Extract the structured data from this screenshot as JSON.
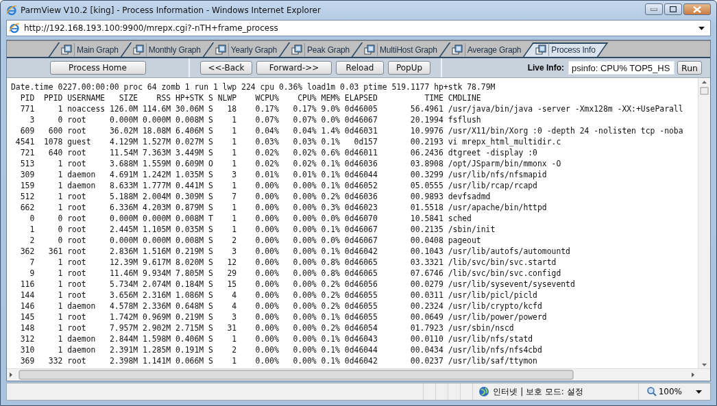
{
  "window": {
    "title": "ParmView V10.2 [king] - Process Information - Windows Internet Explorer"
  },
  "address_bar": {
    "url": "http://192.168.193.100:9900/mrepx.cgi?-nTH+frame_process"
  },
  "tabs": [
    {
      "label": "Main Graph",
      "selected": false
    },
    {
      "label": "Monthly Graph",
      "selected": false
    },
    {
      "label": "Yearly Graph",
      "selected": false
    },
    {
      "label": "Peak Graph",
      "selected": false
    },
    {
      "label": "MultiHost Graph",
      "selected": false
    },
    {
      "label": "Average Graph",
      "selected": false
    },
    {
      "label": "Process Info",
      "selected": true
    }
  ],
  "toolbar": {
    "home_button": "Process Home",
    "nav_buttons": [
      "<<-Back",
      "Forward->>",
      "Reload",
      "PopUp"
    ],
    "live_info_label": "Live Info:",
    "live_info_value": "psinfo: CPU% TOP5_HS",
    "run_button": "Run"
  },
  "process_table": {
    "summary": "Date.time 0227.00:00:00 proc 64 zomb 1 run 1 lwp 224 cpu 0.36% load1m 0.03 ptime 519.1177 hp+stk 78.79M",
    "columns": [
      "PID",
      "PPID",
      "USERNAME",
      "SIZE",
      "RSS",
      "HP+STK",
      "S",
      "NLWP",
      "WCPU%",
      "CPU%",
      "MEM%",
      "ELAPSED",
      "TIME",
      "CMDLINE"
    ],
    "rows": [
      [
        "771",
        "1",
        "noaccess",
        "126.0M",
        "114.6M",
        "30.06M",
        "S",
        "18",
        "0.17%",
        "0.17%",
        "9.0%",
        "0d46005",
        "56.4961",
        "/usr/java/bin/java -server -Xmx128m -XX:+UseParall"
      ],
      [
        "3",
        "0",
        "root",
        "0.000M",
        "0.000M",
        "0.008M",
        "S",
        "1",
        "0.07%",
        "0.07%",
        "0.0%",
        "0d46067",
        "20.1994",
        "fsflush"
      ],
      [
        "609",
        "600",
        "root",
        "36.02M",
        "18.08M",
        "6.406M",
        "S",
        "1",
        "0.04%",
        "0.04%",
        "1.4%",
        "0d46031",
        "10.9976",
        "/usr/X11/bin/Xorg :0 -depth 24 -nolisten tcp -noba"
      ],
      [
        "4541",
        "1078",
        "guest",
        "4.129M",
        "1.527M",
        "0.027M",
        "S",
        "1",
        "0.03%",
        "0.03%",
        "0.1%",
        "0d157",
        "00.2193",
        "vi mrepx_html_multidir.c"
      ],
      [
        "721",
        "640",
        "root",
        "11.54M",
        "7.363M",
        "3.449M",
        "S",
        "1",
        "0.02%",
        "0.02%",
        "0.6%",
        "0d46011",
        "06.2436",
        "dtgreet -display :0"
      ],
      [
        "513",
        "1",
        "root",
        "3.688M",
        "1.559M",
        "0.609M",
        "O",
        "1",
        "0.02%",
        "0.02%",
        "0.1%",
        "0d46036",
        "03.8908",
        "/opt/JSparm/bin/mmonx -O"
      ],
      [
        "309",
        "1",
        "daemon",
        "4.691M",
        "1.242M",
        "1.035M",
        "S",
        "3",
        "0.01%",
        "0.01%",
        "0.1%",
        "0d46044",
        "00.3299",
        "/usr/lib/nfs/nfsmapid"
      ],
      [
        "159",
        "1",
        "daemon",
        "8.633M",
        "1.777M",
        "0.441M",
        "S",
        "1",
        "0.00%",
        "0.00%",
        "0.1%",
        "0d46052",
        "05.0555",
        "/usr/lib/rcap/rcapd"
      ],
      [
        "512",
        "1",
        "root",
        "5.188M",
        "2.004M",
        "0.309M",
        "S",
        "7",
        "0.00%",
        "0.00%",
        "0.2%",
        "0d46036",
        "00.9893",
        "devfsadmd"
      ],
      [
        "662",
        "1",
        "root",
        "6.336M",
        "4.203M",
        "0.879M",
        "S",
        "1",
        "0.00%",
        "0.00%",
        "0.3%",
        "0d46023",
        "01.5518",
        "/usr/apache/bin/httpd"
      ],
      [
        "0",
        "0",
        "root",
        "0.000M",
        "0.000M",
        "0.008M",
        "T",
        "1",
        "0.00%",
        "0.00%",
        "0.0%",
        "0d46070",
        "10.5841",
        "sched"
      ],
      [
        "1",
        "0",
        "root",
        "2.445M",
        "1.105M",
        "0.035M",
        "S",
        "1",
        "0.00%",
        "0.00%",
        "0.1%",
        "0d46067",
        "00.2135",
        "/sbin/init"
      ],
      [
        "2",
        "0",
        "root",
        "0.000M",
        "0.000M",
        "0.008M",
        "S",
        "2",
        "0.00%",
        "0.00%",
        "0.0%",
        "0d46067",
        "00.0408",
        "pageout"
      ],
      [
        "362",
        "361",
        "root",
        "2.836M",
        "1.516M",
        "0.219M",
        "S",
        "3",
        "0.00%",
        "0.00%",
        "0.1%",
        "0d46042",
        "00.1043",
        "/usr/lib/autofs/automountd"
      ],
      [
        "7",
        "1",
        "root",
        "12.39M",
        "9.617M",
        "8.020M",
        "S",
        "12",
        "0.00%",
        "0.00%",
        "0.8%",
        "0d46065",
        "03.3321",
        "/lib/svc/bin/svc.startd"
      ],
      [
        "9",
        "1",
        "root",
        "11.46M",
        "9.934M",
        "7.805M",
        "S",
        "29",
        "0.00%",
        "0.00%",
        "0.8%",
        "0d46065",
        "07.6746",
        "/lib/svc/bin/svc.configd"
      ],
      [
        "116",
        "1",
        "root",
        "5.734M",
        "2.074M",
        "0.184M",
        "S",
        "15",
        "0.00%",
        "0.00%",
        "0.2%",
        "0d46056",
        "00.0279",
        "/usr/lib/sysevent/syseventd"
      ],
      [
        "144",
        "1",
        "root",
        "3.656M",
        "2.316M",
        "1.086M",
        "S",
        "4",
        "0.00%",
        "0.00%",
        "0.2%",
        "0d46055",
        "00.0311",
        "/usr/lib/picl/picld"
      ],
      [
        "146",
        "1",
        "daemon",
        "4.578M",
        "2.336M",
        "0.648M",
        "S",
        "4",
        "0.00%",
        "0.00%",
        "0.2%",
        "0d46055",
        "00.2324",
        "/usr/lib/crypto/kcfd"
      ],
      [
        "145",
        "1",
        "root",
        "1.742M",
        "0.969M",
        "0.219M",
        "S",
        "3",
        "0.00%",
        "0.00%",
        "0.1%",
        "0d46055",
        "00.0649",
        "/usr/lib/power/powerd"
      ],
      [
        "148",
        "1",
        "root",
        "7.957M",
        "2.902M",
        "2.715M",
        "S",
        "31",
        "0.00%",
        "0.00%",
        "0.2%",
        "0d46054",
        "01.7923",
        "/usr/sbin/nscd"
      ],
      [
        "312",
        "1",
        "daemon",
        "2.844M",
        "1.598M",
        "0.406M",
        "S",
        "1",
        "0.00%",
        "0.00%",
        "0.1%",
        "0d46043",
        "00.0110",
        "/usr/lib/nfs/statd"
      ],
      [
        "310",
        "1",
        "daemon",
        "2.391M",
        "1.285M",
        "0.191M",
        "S",
        "2",
        "0.00%",
        "0.00%",
        "0.1%",
        "0d46044",
        "00.0434",
        "/usr/lib/nfs/nfs4cbd"
      ],
      [
        "369",
        "332",
        "root",
        "2.398M",
        "1.141M",
        "0.066M",
        "S",
        "1",
        "0.00%",
        "0.00%",
        "0.1%",
        "0d46042",
        "00.0237",
        "/usr/lib/saf/ttymon"
      ]
    ]
  },
  "status_bar": {
    "zone": "인터넷 | 보호 모드: 설정",
    "zoom": "100%"
  }
}
